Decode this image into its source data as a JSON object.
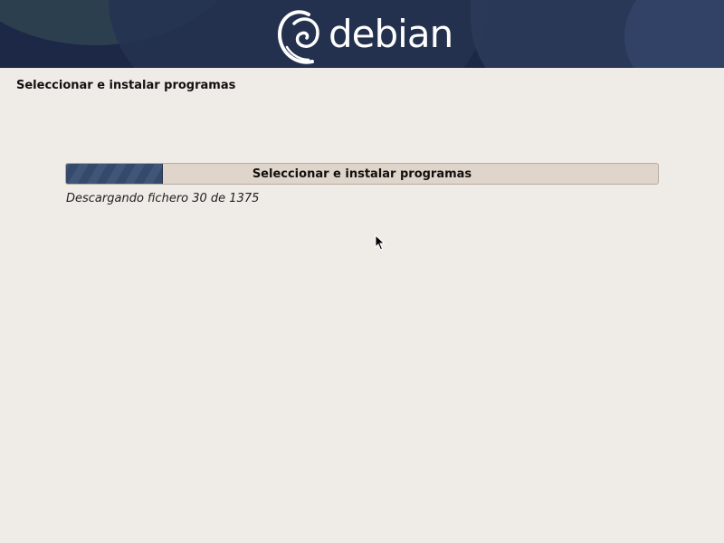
{
  "header": {
    "logo_text": "debian",
    "logo_icon": "debian-swirl-icon",
    "colors": {
      "banner": "#1c2845",
      "logo": "#ffffff"
    }
  },
  "page": {
    "title": "Seleccionar e instalar programas"
  },
  "progress": {
    "label": "Seleccionar e instalar programas",
    "fraction": 0.162,
    "status": "Descargando fichero 30 de 1375",
    "fill_color": "#354a6b",
    "track_color": "#e0d5ca"
  },
  "pointer": {
    "icon": "mouse-cursor-icon"
  }
}
